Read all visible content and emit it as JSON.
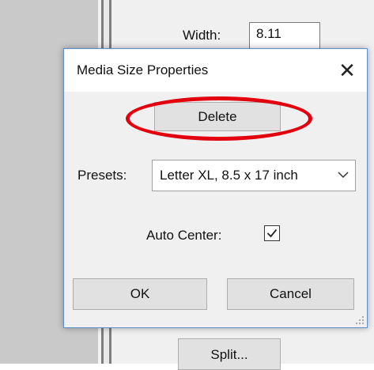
{
  "background_window": {
    "width_label": "Width:",
    "width_value": "8.11",
    "split_button_label": "Split..."
  },
  "dialog": {
    "title": "Media Size Properties",
    "close_icon": "close-icon",
    "delete_button_label": "Delete",
    "presets_label": "Presets:",
    "presets_value": "Letter XL, 8.5 x 17 inch",
    "auto_center_label": "Auto Center:",
    "auto_center_checked": true,
    "ok_button_label": "OK",
    "cancel_button_label": "Cancel"
  },
  "colors": {
    "highlight": "#e3000f",
    "dialog_border": "#5b8fd1",
    "dialog_bg": "#f0f0f0"
  }
}
